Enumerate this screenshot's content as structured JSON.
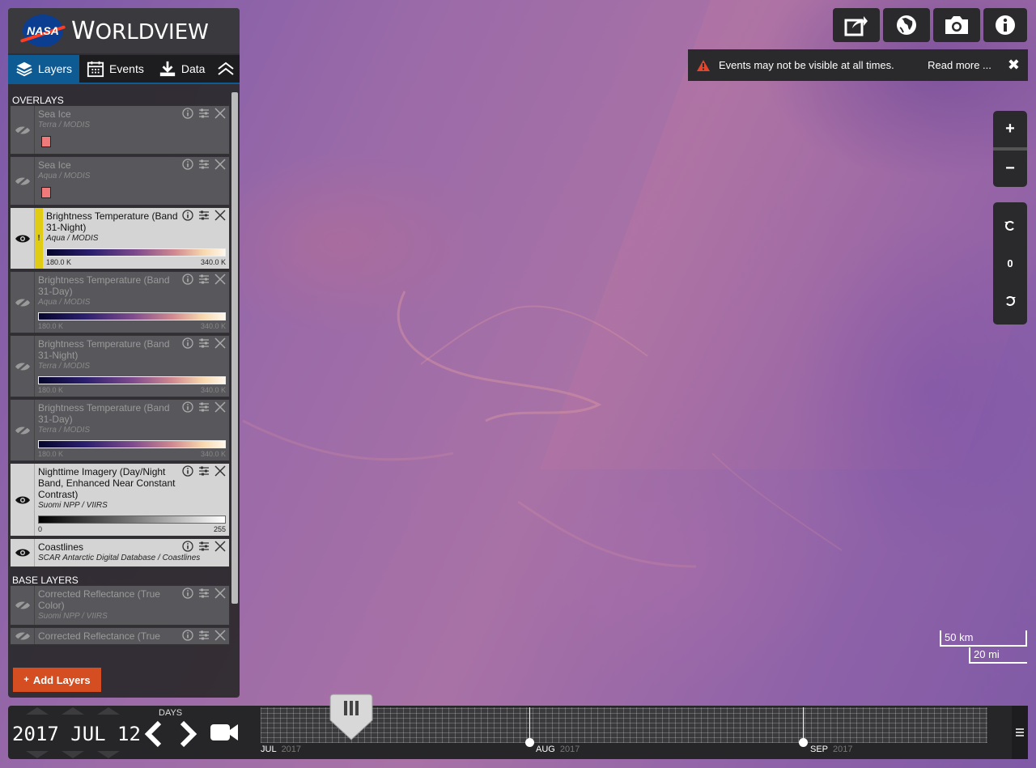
{
  "app": {
    "title_big": "W",
    "title_rest": "ORLDVIEW",
    "logo_text": "NASA"
  },
  "tabs": [
    {
      "label": "Layers",
      "icon": "layers-icon",
      "active": true
    },
    {
      "label": "Events",
      "icon": "calendar-icon",
      "active": false
    },
    {
      "label": "Data",
      "icon": "download-icon",
      "active": false
    }
  ],
  "sections": {
    "overlays": "OVERLAYS",
    "base": "BASE LAYERS"
  },
  "overlays": [
    {
      "name": "Sea Ice",
      "source": "Terra / MODIS",
      "visible": false,
      "legend": "swatch",
      "swatch_color": "#f07a7a"
    },
    {
      "name": "Sea Ice",
      "source": "Aqua / MODIS",
      "visible": false,
      "legend": "swatch",
      "swatch_color": "#f07a7a"
    },
    {
      "name": "Brightness Temperature (Band 31-Night)",
      "source": "Aqua / MODIS",
      "visible": true,
      "warning": "!",
      "legend": "bt",
      "min": "180.0 K",
      "max": "340.0 K"
    },
    {
      "name": "Brightness Temperature (Band 31-Day)",
      "source": "Aqua / MODIS",
      "visible": false,
      "legend": "bt",
      "min": "180.0 K",
      "max": "340.0 K"
    },
    {
      "name": "Brightness Temperature (Band 31-Night)",
      "source": "Terra / MODIS",
      "visible": false,
      "legend": "bt",
      "min": "180.0 K",
      "max": "340.0 K"
    },
    {
      "name": "Brightness Temperature (Band 31-Day)",
      "source": "Terra / MODIS",
      "visible": false,
      "legend": "bt",
      "min": "180.0 K",
      "max": "340.0 K"
    },
    {
      "name": "Nighttime Imagery (Day/Night Band, Enhanced Near Constant Contrast)",
      "source": "Suomi NPP / VIIRS",
      "visible": true,
      "legend": "gray",
      "min": "0",
      "max": "255"
    },
    {
      "name": "Coastlines",
      "source": "SCAR Antarctic Digital Database / Coastlines",
      "visible": true,
      "legend": "none"
    }
  ],
  "base_layers": [
    {
      "name": "Corrected Reflectance (True Color)",
      "source": "Suomi NPP / VIIRS",
      "visible": false
    },
    {
      "name": "Corrected Reflectance (True",
      "source": "",
      "visible": false
    }
  ],
  "add_layers_label": "Add Layers",
  "add_layers_prefix": "+",
  "alert": {
    "message": "Events may not be visible at all times.",
    "read_more": "Read more ...",
    "close": "✖"
  },
  "zoom": {
    "in": "+",
    "out": "−"
  },
  "rotation": {
    "value": "0"
  },
  "scale": {
    "km": "50 km",
    "mi": "20 mi"
  },
  "timeline": {
    "date": "2017 JUL 12",
    "interval_label": "DAYS",
    "months": [
      {
        "label": "JUL",
        "year": "2017"
      },
      {
        "label": "AUG",
        "year": "2017"
      },
      {
        "label": "SEP",
        "year": "2017"
      }
    ]
  },
  "toolbar_icons": [
    "share-icon",
    "globe-icon",
    "camera-icon",
    "info-icon"
  ]
}
